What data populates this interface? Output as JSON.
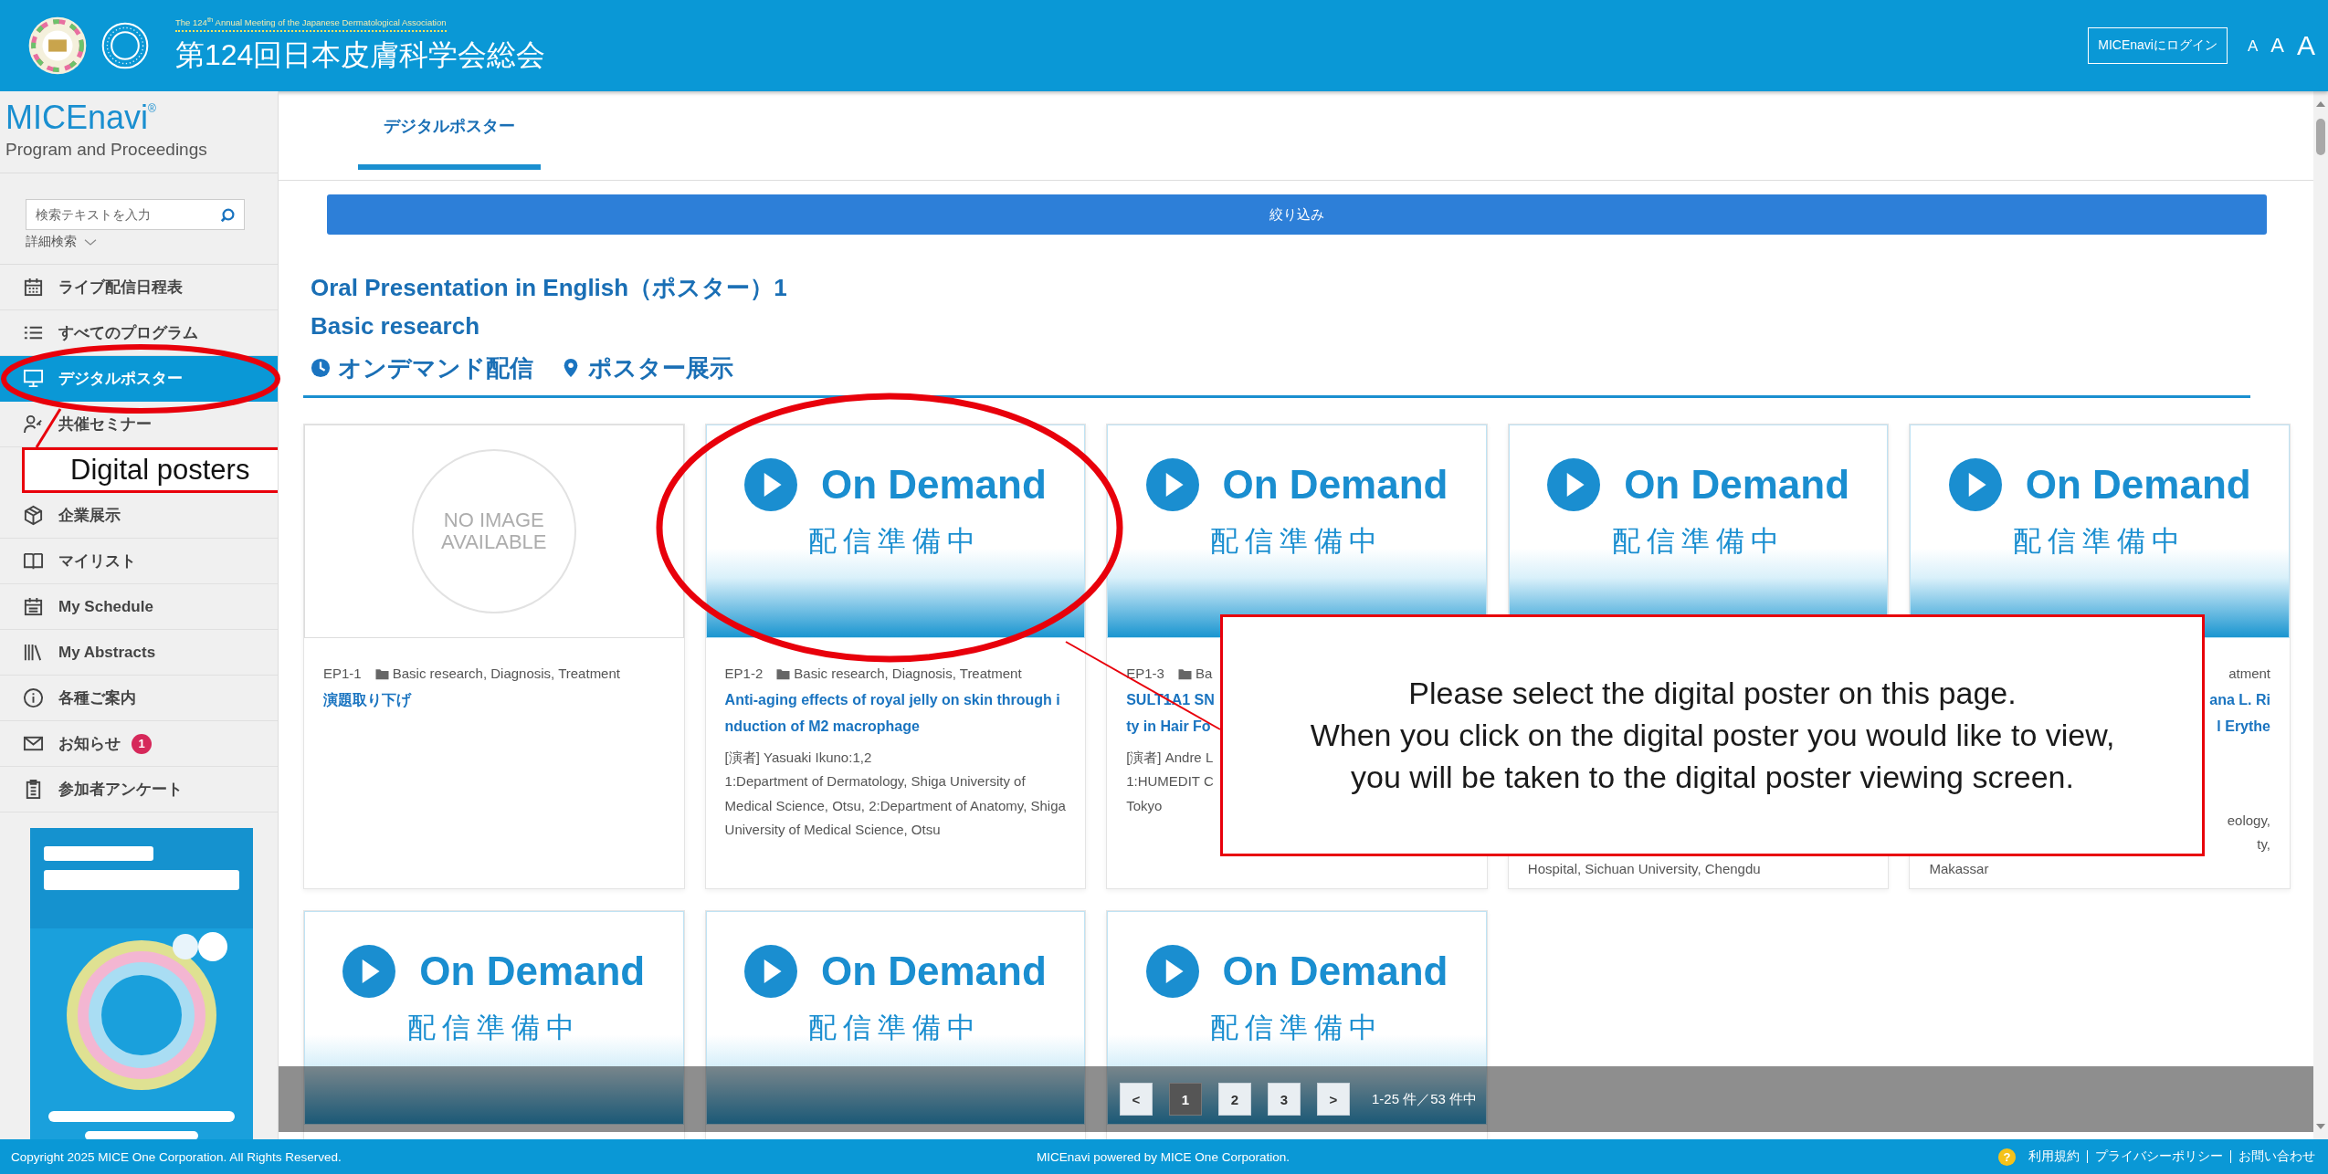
{
  "header": {
    "subtitle": "The 124$^{th}$ Annual Meeting of the Japanese Dermatological Association",
    "title": "第124回日本皮膚科学会総会",
    "login_button": "MICEnaviにログイン",
    "font_size_buttons": [
      "A",
      "A",
      "A"
    ]
  },
  "sidebar": {
    "logo": "MICEnavi",
    "logo_mark": "®",
    "tagline": "Program and Proceedings",
    "search": {
      "placeholder": "検索テキストを入力"
    },
    "advanced_search": "詳細検索",
    "items": [
      {
        "kind": "nav",
        "label": "ライブ配信日程表",
        "selected": false
      },
      {
        "kind": "nav",
        "label": "すべてのプログラム",
        "selected": false
      },
      {
        "kind": "nav",
        "label": "デジタルポスター",
        "selected": true
      },
      {
        "kind": "nav",
        "label": "共催セミナー",
        "selected": false
      },
      {
        "kind": "annotation",
        "label": "Digital posters"
      },
      {
        "kind": "nav",
        "label": "企業展示",
        "selected": false
      },
      {
        "kind": "nav",
        "label": "マイリスト",
        "selected": false
      },
      {
        "kind": "nav",
        "label": "My Schedule",
        "selected": false
      },
      {
        "kind": "nav",
        "label": "My Abstracts",
        "selected": false
      },
      {
        "kind": "nav",
        "label": "各種ご案内",
        "selected": false
      },
      {
        "kind": "nav",
        "label": "お知らせ",
        "selected": false,
        "badge": "1"
      },
      {
        "kind": "nav",
        "label": "参加者アンケート",
        "selected": false
      }
    ]
  },
  "tabs": [
    {
      "label": "デジタルポスター",
      "selected": true
    }
  ],
  "filter_button": "絞り込み",
  "section": {
    "title": "Oral Presentation in English（ポスター）1",
    "subtitle": "Basic research",
    "tags": [
      "オンデマンド配信",
      "ポスター展示"
    ]
  },
  "cards": [
    {
      "thumbnail": {
        "kind": "no_image",
        "label": "NO IMAGE AVAILABLE"
      },
      "top_lines": [
        {
          "kind": "meta",
          "id": "EP1-1",
          "category": "Basic research, Diagnosis, Treatment"
        },
        {
          "kind": "title",
          "text": "演題取り下げ"
        }
      ]
    },
    {
      "thumbnail": {
        "kind": "on_demand",
        "label": "On Demand",
        "sublabel": "配信準備中"
      },
      "top_lines": [
        {
          "kind": "meta",
          "id": "EP1-2",
          "category": "Basic research, Diagnosis, Treatment"
        },
        {
          "kind": "title",
          "text": "Anti-aging effects of royal jelly on skin through induction of M2 macrophage"
        },
        {
          "kind": "speaker",
          "text": "[演者] Yasuaki Ikuno:1,2"
        },
        {
          "kind": "affiliation",
          "text": "1:Department of Dermatology, Shiga University of Medical Science, Otsu, 2:Department of Anatomy, Shiga University of Medical Science, Otsu"
        }
      ]
    },
    {
      "thumbnail": {
        "kind": "on_demand",
        "label": "On Demand",
        "sublabel": "配信準備中"
      },
      "top_lines": [
        {
          "kind": "meta",
          "id": "EP1-3",
          "category": "Ba"
        },
        {
          "kind": "title",
          "text": "SULT1A1 SN"
        },
        {
          "kind": "title",
          "text": "ty in Hair Fo"
        },
        {
          "kind": "speaker",
          "text": "[演者] Andre L"
        },
        {
          "kind": "affiliation",
          "text": "1:HUMEDIT C"
        },
        {
          "kind": "affiliation",
          "text": "Tokyo"
        }
      ]
    },
    {
      "thumbnail": {
        "kind": "on_demand",
        "label": "On Demand",
        "sublabel": "配信準備中"
      },
      "bottom_lines": [
        {
          "kind": "affiliation",
          "text": "Hospital, Sichuan University, Chengdu"
        }
      ]
    },
    {
      "thumbnail": {
        "kind": "on_demand",
        "label": "On Demand",
        "sublabel": "配信準備中"
      },
      "top_lines": [
        {
          "kind": "meta",
          "category": "atment",
          "cut": true
        },
        {
          "kind": "title",
          "text": "ana L. Ri",
          "cut": true
        },
        {
          "kind": "title",
          "text": "l Erythe",
          "cut": true
        }
      ],
      "bottom_lines": [
        {
          "kind": "affiliation",
          "text": "eology,",
          "cut": true
        },
        {
          "kind": "affiliation",
          "text": "ty,",
          "cut": true
        },
        {
          "kind": "affiliation",
          "text": "Makassar"
        }
      ]
    },
    {
      "thumbnail": {
        "kind": "on_demand",
        "label": "On Demand",
        "sublabel": "配信準備中"
      }
    },
    {
      "thumbnail": {
        "kind": "on_demand",
        "label": "On Demand",
        "sublabel": "配信準備中"
      }
    },
    {
      "thumbnail": {
        "kind": "on_demand",
        "label": "On Demand",
        "sublabel": "配信準備中"
      }
    }
  ],
  "pagination": {
    "pages": [
      {
        "label": "<",
        "selected": false
      },
      {
        "label": "1",
        "selected": true
      },
      {
        "label": "2",
        "selected": false
      },
      {
        "label": "3",
        "selected": false
      },
      {
        "label": ">",
        "selected": false
      }
    ],
    "summary": "1-25 件／53 件中"
  },
  "footer": {
    "copyright": "Copyright 2025 MICE One Corporation. All Rights Reserved.",
    "powered_by": "MICEnavi powered by MICE One Corporation.",
    "help_icon": "?",
    "links": [
      "利用規約",
      "プライバシーポリシー",
      "お問い合わせ"
    ]
  },
  "callout": {
    "text": "Please select the digital poster on this page.\nWhen you click on the digital poster you would like to view,\nyou will be taken to the digital poster viewing screen."
  }
}
